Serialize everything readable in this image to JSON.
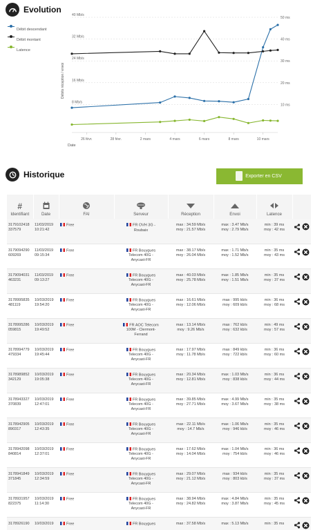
{
  "evolution": {
    "title": "Evolution",
    "legend": [
      {
        "label": "Débit descendant",
        "color": "#2a6fa8",
        "marker_color": "#2a6fa8"
      },
      {
        "label": "Débit montant",
        "color": "#222222",
        "marker_color": "#222222"
      },
      {
        "label": "Latence",
        "color": "#86b62e",
        "marker_color": "#86b62e"
      }
    ]
  },
  "chart_data": {
    "type": "line",
    "ylabel": "Débits réception / envoi",
    "y_left_ticks": [
      "40 Mb/s",
      "32 Mb/s",
      "24 Mb/s",
      "16 Mb/s",
      "8 Mb/s"
    ],
    "y_right_ticks": [
      "50 ms",
      "40 ms",
      "30 ms",
      "20 ms",
      "10 ms"
    ],
    "ylim_left": [
      0,
      40
    ],
    "ylim_right": [
      0,
      50
    ],
    "x_ticks": [
      "26 févr.",
      "28 févr.",
      "2 mars",
      "4 mars",
      "6 mars",
      "8 mars",
      "10 mars"
    ],
    "xlabel": "Date",
    "x": [
      "2019-02-25",
      "2019-03-03",
      "2019-03-04",
      "2019-03-05",
      "2019-03-06",
      "2019-03-07",
      "2019-03-08",
      "2019-03-09",
      "2019-03-10",
      "2019-03-10 12:00",
      "2019-03-11"
    ],
    "series": [
      {
        "name": "Débit descendant",
        "axis": "left",
        "color": "#2a6fa8",
        "values": [
          6.8,
          8.7,
          10.9,
          10.4,
          9.3,
          9.2,
          8.8,
          10.0,
          29.0,
          35.6,
          37.2
        ]
      },
      {
        "name": "Débit montant",
        "axis": "left",
        "color": "#222222",
        "values": [
          26.6,
          27.5,
          26.6,
          26.6,
          34.9,
          27.0,
          26.9,
          26.9,
          27.5,
          27.8,
          28.0
        ]
      },
      {
        "name": "Latence",
        "axis": "right",
        "color": "#86b62e",
        "values": [
          0.8,
          2.0,
          2.5,
          3.0,
          2.4,
          4.2,
          3.4,
          1.5,
          2.7,
          2.6,
          2.5
        ]
      }
    ],
    "grid": true,
    "legend_position": "left"
  },
  "historique": {
    "title": "Historique",
    "export_label": "Exporter en CSV",
    "columns": [
      "Identifiant",
      "Date",
      "FAI",
      "Serveur",
      "Réception",
      "Envoi",
      "Latence"
    ],
    "rows": [
      {
        "id1": "3179102418",
        "id2": "337579",
        "date": "11/03/2019",
        "time": "10:21:42",
        "fai": "Free",
        "server": [
          "FR OVH 3G -",
          "Roubaix"
        ],
        "rec_max": "max : 34.59 Mb/s",
        "rec_moy": "moy : 21.57 Mb/s",
        "env_max": "max : 3.47 Mb/s",
        "env_moy": "moy : 2.79 Mb/s",
        "lat_min": "min : 39 ms",
        "lat_moy": "moy : 42 ms"
      },
      {
        "id1": "3179094290",
        "id2": "609269",
        "date": "11/03/2019",
        "time": "09:15:34",
        "fai": "Free",
        "server": [
          "FR Bouygues",
          "Telecom 40G -",
          "Anycast-FR"
        ],
        "rec_max": "max : 38.17 Mb/s",
        "rec_moy": "moy : 26.04 Mb/s",
        "env_max": "max : 1.71 Mb/s",
        "env_moy": "moy : 1.52 Mb/s",
        "lat_min": "min : 35 ms",
        "lat_moy": "moy : 43 ms"
      },
      {
        "id1": "3179094031",
        "id2": "463231",
        "date": "11/03/2019",
        "time": "09:13:27",
        "fai": "Free",
        "server": [
          "FR Bouygues",
          "Telecom 40G -",
          "Anycast-FR"
        ],
        "rec_max": "max : 40.03 Mb/s",
        "rec_moy": "moy : 25.78 Mb/s",
        "env_max": "max : 1.85 Mb/s",
        "env_moy": "moy : 1.51 Mb/s",
        "lat_min": "min : 35 ms",
        "lat_moy": "moy : 37 ms"
      },
      {
        "id1": "3178995835",
        "id2": "481119",
        "date": "10/03/2019",
        "time": "19:54:20",
        "fai": "Free",
        "server": [
          "FR Bouygues",
          "Telecom 40G -",
          "Anycast-FR"
        ],
        "rec_max": "max : 16.61 Mb/s",
        "rec_moy": "moy : 12.06 Mb/s",
        "env_max": "max : 995 kb/s",
        "env_moy": "moy : 609 kb/s",
        "lat_min": "min : 36 ms",
        "lat_moy": "moy : 68 ms"
      },
      {
        "id1": "3178995286",
        "id2": "059815",
        "date": "10/03/2019",
        "time": "19:49:52",
        "fai": "Free",
        "server": [
          "FR AOC Telecom",
          "100M - Clermont-",
          "Ferrand"
        ],
        "rec_max": "max : 13.14 Mb/s",
        "rec_moy": "moy : 9.26 Mb/s",
        "env_max": "max : 762 kb/s",
        "env_moy": "moy : 632 kb/s",
        "lat_min": "min : 49 ms",
        "lat_moy": "moy : 57 ms"
      },
      {
        "id1": "3178994779",
        "id2": "479334",
        "date": "10/03/2019",
        "time": "19:45:44",
        "fai": "Free",
        "server": [
          "FR Bouygues",
          "Telecom 40G -",
          "Anycast-FR"
        ],
        "rec_max": "max : 17.97 Mb/s",
        "rec_moy": "moy : 11.78 Mb/s",
        "env_max": "max : 849 kb/s",
        "env_moy": "moy : 722 kb/s",
        "lat_min": "min : 36 ms",
        "lat_moy": "moy : 60 ms"
      },
      {
        "id1": "3178989852",
        "id2": "342129",
        "date": "10/03/2019",
        "time": "19:05:38",
        "fai": "Free",
        "server": [
          "FR Bouygues",
          "Telecom 40G -",
          "Anycast-FR"
        ],
        "rec_max": "max : 20.34 Mb/s",
        "rec_moy": "moy : 12.81 Mb/s",
        "env_max": "max : 1.03 Mb/s",
        "env_moy": "moy : 838 kb/s",
        "lat_min": "min : 36 ms",
        "lat_moy": "moy : 44 ms"
      },
      {
        "id1": "3178943327",
        "id2": "370839",
        "date": "10/03/2019",
        "time": "12:47:01",
        "fai": "Free",
        "server": [
          "FR Bouygues",
          "Telecom 40G -",
          "Anycast-FR"
        ],
        "rec_max": "max : 39.85 Mb/s",
        "rec_moy": "moy : 27.71 Mb/s",
        "env_max": "max : 4.99 Mb/s",
        "env_moy": "moy : 3.67 Mb/s",
        "lat_min": "min : 35 ms",
        "lat_moy": "moy : 38 ms"
      },
      {
        "id1": "3178942905",
        "id2": "890317",
        "date": "10/03/2019",
        "time": "12:43:35",
        "fai": "Free",
        "server": [
          "FR Bouygues",
          "Telecom 40G -",
          "Anycast-FR"
        ],
        "rec_max": "max : 22.11 Mb/s",
        "rec_moy": "moy : 14.7 Mb/s",
        "env_max": "max : 1.06 Mb/s",
        "env_moy": "moy : 946 kb/s",
        "lat_min": "min : 35 ms",
        "lat_moy": "moy : 46 ms"
      },
      {
        "id1": "3178942098",
        "id2": "840814",
        "date": "10/03/2019",
        "time": "12:37:01",
        "fai": "Free",
        "server": [
          "FR Bouygues",
          "Telecom 40G -",
          "Anycast-FR"
        ],
        "rec_max": "max : 17.62 Mb/s",
        "rec_moy": "moy : 14.04 Mb/s",
        "env_max": "max : 1.04 Mb/s",
        "env_moy": "moy : 754 kb/s",
        "lat_min": "min : 36 ms",
        "lat_moy": "moy : 46 ms"
      },
      {
        "id1": "3178941849",
        "id2": "371845",
        "date": "10/03/2019",
        "time": "12:34:59",
        "fai": "Free",
        "server": [
          "FR Bouygues",
          "Telecom 40G -",
          "Anycast-FR"
        ],
        "rec_max": "max : 29.07 Mb/s",
        "rec_moy": "moy : 21.12 Mb/s",
        "env_max": "max : 934 kb/s",
        "env_moy": "moy : 803 kb/s",
        "lat_min": "min : 35 ms",
        "lat_moy": "moy : 37 ms"
      },
      {
        "id1": "3178931957",
        "id2": "822375",
        "date": "10/03/2019",
        "time": "11:14:30",
        "fai": "Free",
        "server": [
          "FR Bouygues",
          "Telecom 40G -",
          "Anycast-FR"
        ],
        "rec_max": "max : 38.94 Mb/s",
        "rec_moy": "moy : 24.82 Mb/s",
        "env_max": "max : 4.84 Mb/s",
        "env_moy": "moy : 3.87 Mb/s",
        "lat_min": "min : 35 ms",
        "lat_moy": "moy : 45 ms"
      },
      {
        "id1": "3178926190",
        "id2": "",
        "date": "10/03/2019",
        "time": "",
        "fai": "Free",
        "server": [
          "FR Bouygues"
        ],
        "rec_max": "max : 37.58 Mb/s",
        "rec_moy": "",
        "env_max": "max : 5.13 Mb/s",
        "env_moy": "",
        "lat_min": "min : 35 ms",
        "lat_moy": ""
      }
    ]
  }
}
